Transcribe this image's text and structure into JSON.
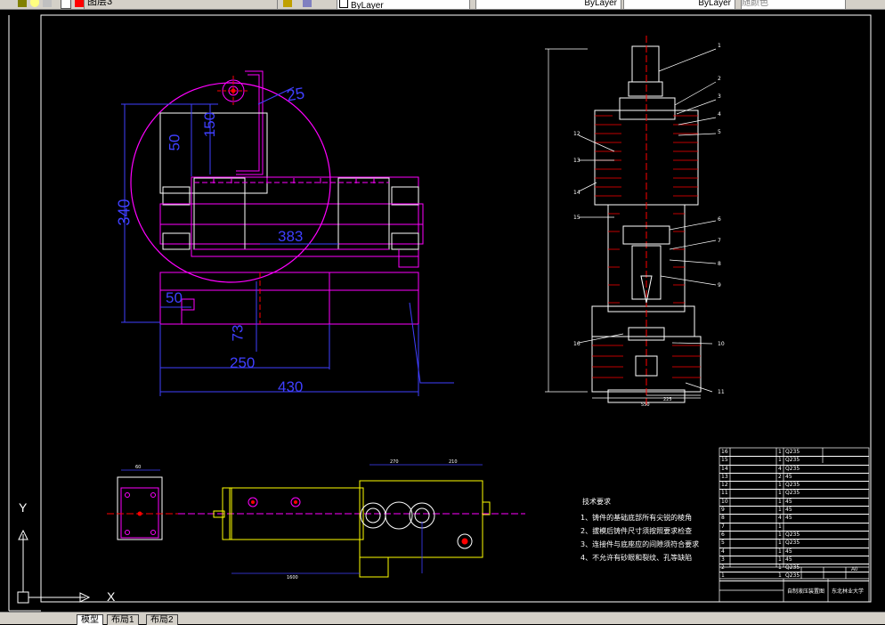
{
  "toolbar": {
    "layer_name": "图层3",
    "color_value": "ByLayer",
    "linetype_value": "ByLayer",
    "lineweight_value": "ByLayer",
    "plotstyle_value": "随颜色"
  },
  "colors": {
    "background": "#000000",
    "magenta": "#ff00ff",
    "white": "#ffffff",
    "yellow": "#ffff00",
    "blue": "#3f3fff",
    "red": "#ff0000",
    "cyan": "#00c0ff"
  },
  "drawing": {
    "left_view": {
      "dimensions": [
        "25",
        "150",
        "50",
        "340",
        "383",
        "50",
        "73",
        "250",
        "430"
      ]
    },
    "section_view": {
      "balloons": [
        "1",
        "2",
        "3",
        "4",
        "5",
        "6",
        "7",
        "8",
        "9",
        "10",
        "11",
        "12",
        "13",
        "14",
        "15",
        "16"
      ],
      "bottom_dims": [
        "225",
        "550"
      ]
    },
    "bottom_view": {
      "dims": [
        "60",
        "270",
        "210",
        "1600"
      ]
    },
    "tech_requirements": {
      "title": "技术要求",
      "items": [
        "1、铸件的基础底部所有尖锐的棱角",
        "2、拔模后铸件尺寸须按照要求检查",
        "3、连接件与底座应的间隙须符合要求",
        "4、不允许有砂眼和裂纹、孔等缺陷"
      ]
    },
    "bom": {
      "rows": [
        {
          "no": "16",
          "qty": "1",
          "mat": "Q235"
        },
        {
          "no": "15",
          "qty": "1",
          "mat": "Q235"
        },
        {
          "no": "14",
          "qty": "4",
          "mat": "Q235"
        },
        {
          "no": "13",
          "qty": "2",
          "mat": "45"
        },
        {
          "no": "12",
          "qty": "1",
          "mat": "Q235"
        },
        {
          "no": "11",
          "qty": "1",
          "mat": "Q235"
        },
        {
          "no": "10",
          "qty": "1",
          "mat": "45"
        },
        {
          "no": "9",
          "qty": "1",
          "mat": "45"
        },
        {
          "no": "8",
          "qty": "4",
          "mat": "45"
        },
        {
          "no": "7",
          "qty": "1",
          "mat": ""
        },
        {
          "no": "6",
          "qty": "1",
          "mat": "Q235"
        },
        {
          "no": "5",
          "qty": "1",
          "mat": "Q235"
        },
        {
          "no": "4",
          "qty": "1",
          "mat": "45"
        },
        {
          "no": "3",
          "qty": "1",
          "mat": "45"
        },
        {
          "no": "2",
          "qty": "1",
          "mat": "Q235"
        },
        {
          "no": "1",
          "qty": "1",
          "mat": "Q235"
        }
      ],
      "scale": "A0",
      "title_name": "自制液压装置图",
      "school": "东北林业大学"
    }
  },
  "ucs": {
    "y_label": "Y",
    "x_label": "X"
  },
  "tabs": [
    "模型",
    "布局1",
    "布局2"
  ]
}
